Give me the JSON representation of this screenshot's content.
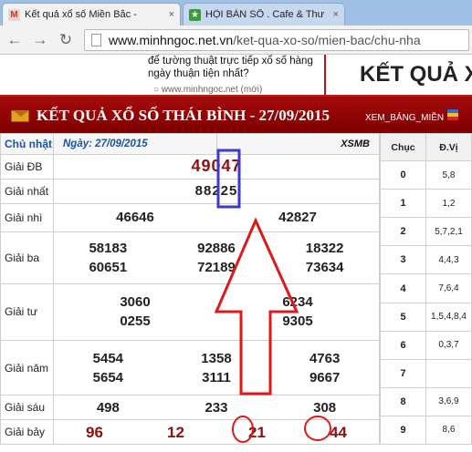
{
  "browser": {
    "tabs": [
      {
        "title": "Kết quả xổ số Miền Bắc -",
        "close": "×"
      },
      {
        "title": "HỘI BÀN SỐ . Cafe & Thư",
        "close": "×"
      }
    ],
    "url_host": "www.minhngoc.net.vn",
    "url_path": "/ket-qua-xo-so/mien-bac/chu-nha"
  },
  "background": {
    "promo_text": "để tường thuật trực tiếp xổ số hàng ngày thuận tiện nhất?",
    "promo_link": "○ www.minhngoc.net (mới)",
    "big_title": "KẾT QUẢ X"
  },
  "panel": {
    "title": "KẾT QUẢ XỔ SỐ THÁI BÌNH - 27/09/2015",
    "view_link": "XEM_BẢNG_MIỀN",
    "day": "Chủ nhật",
    "date_label": "Ngày: 27/09/2015",
    "region": "XSMB"
  },
  "prizes": {
    "db": {
      "label": "Giải ĐB",
      "value": "49047"
    },
    "nhat": {
      "label": "Giải nhất",
      "value": "88225"
    },
    "nhi": {
      "label": "Giải nhì",
      "values": [
        "46646",
        "42827"
      ]
    },
    "ba": {
      "label": "Giải ba",
      "values": [
        "58183",
        "92886",
        "18322",
        "60651",
        "72189",
        "73634"
      ]
    },
    "tu": {
      "label": "Giải tư",
      "values": [
        "3060",
        "6234",
        "0255",
        "9305"
      ]
    },
    "nam": {
      "label": "Giải năm",
      "values": [
        "5454",
        "1358",
        "4763",
        "5654",
        "3111",
        "9667"
      ]
    },
    "sau": {
      "label": "Giải sáu",
      "values": [
        "498",
        "233",
        "308"
      ]
    },
    "bay": {
      "label": "Giải bảy",
      "values": [
        "96",
        "12",
        "21",
        "44"
      ]
    }
  },
  "loto": {
    "head_col": "Chục",
    "tail_col": "Đ.Vị",
    "rows": [
      {
        "digit": "0",
        "tails": "5,8"
      },
      {
        "digit": "1",
        "tails": "1,2"
      },
      {
        "digit": "2",
        "tails": "5,7,2,1"
      },
      {
        "digit": "3",
        "tails": "4,4,3"
      },
      {
        "digit": "4",
        "tails": "7,6,4"
      },
      {
        "digit": "5",
        "tails": "1,5,4,8,4"
      },
      {
        "digit": "6",
        "tails": "0,3,7"
      },
      {
        "digit": "7",
        "tails": ""
      },
      {
        "digit": "8",
        "tails": "3,6,9"
      },
      {
        "digit": "9",
        "tails": "8,6"
      }
    ]
  },
  "annotation_colors": {
    "box": "#3a3ad0",
    "arrow": "#e01818",
    "circle": "#e01818"
  }
}
